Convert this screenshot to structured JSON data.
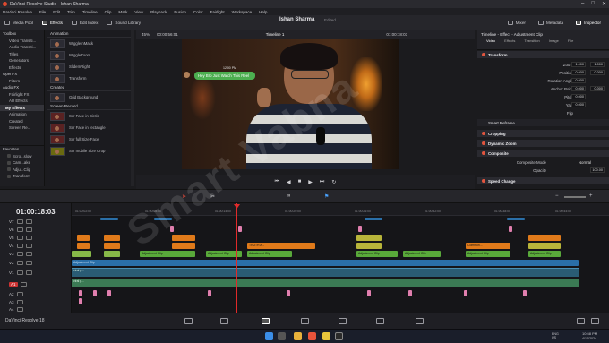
{
  "window": {
    "title": "DaVinci Resolve Studio - Ishan Sharma",
    "min": "–",
    "max": "□",
    "close": "✕"
  },
  "menu": [
    "DaVinci Resolve",
    "File",
    "Edit",
    "Trim",
    "Timeline",
    "Clip",
    "Mark",
    "View",
    "Playback",
    "Fusion",
    "Color",
    "Fairlight",
    "Workspace",
    "Help"
  ],
  "toolbar": {
    "media_pool": "Media Pool",
    "effects": "Effects",
    "edit_index": "Edit Index",
    "sound_library": "Sound Library",
    "project_name": "Ishan Sharma",
    "project_state": "Edited",
    "mixer": "Mixer",
    "metadata": "Metadata",
    "inspector": "Inspector"
  },
  "left_tree": {
    "items": [
      {
        "label": "Toolbox",
        "level": "head"
      },
      {
        "label": "Video Transiti...",
        "level": "sub"
      },
      {
        "label": "Audio Transiti...",
        "level": "sub"
      },
      {
        "label": "Titles",
        "level": "sub"
      },
      {
        "label": "Generators",
        "level": "sub"
      },
      {
        "label": "Effects",
        "level": "sub"
      },
      {
        "label": "OpenFX",
        "level": "head"
      },
      {
        "label": "Filters",
        "level": "sub"
      },
      {
        "label": "Audio FX",
        "level": "head"
      },
      {
        "label": "Fairlight FX",
        "level": "sub"
      },
      {
        "label": "AU Effects",
        "level": "sub"
      },
      {
        "label": "My Effects",
        "level": "selected"
      },
      {
        "label": "Animation",
        "level": "sub"
      },
      {
        "label": "Created",
        "level": "sub"
      },
      {
        "label": "Screen Re...",
        "level": "sub"
      }
    ],
    "favorites_title": "Favorites",
    "favorites": [
      "Scro...slow",
      "Cam...ake",
      "Adju...Clip",
      "Transform"
    ]
  },
  "fx_list": {
    "sections": [
      {
        "title": "Animation",
        "items": [
          {
            "label": "WiggleInMask",
            "thumb": "normal"
          },
          {
            "label": "WiggleZoom",
            "thumb": "normal"
          },
          {
            "label": "SlideInRight",
            "thumb": "normal"
          },
          {
            "label": "Transform",
            "thumb": "normal"
          }
        ]
      },
      {
        "title": "Created",
        "items": [
          {
            "label": "Grid Background",
            "thumb": "normal"
          }
        ]
      },
      {
        "title": "Screen Record",
        "items": [
          {
            "label": "Scr Face in Circle",
            "thumb": "red"
          },
          {
            "label": "Scr Face in rectangle",
            "thumb": "red"
          },
          {
            "label": "Scr full Size Face",
            "thumb": "red"
          },
          {
            "label": "Scr mobile Size Crop",
            "thumb": "yellow"
          }
        ]
      }
    ]
  },
  "viewer": {
    "zoom": "45%",
    "source_tc": "00:00:56:01",
    "timeline_name": "Timeline 1",
    "record_tc": "01:00:18:03",
    "chat_text": "Hey Bro Just Watch This Reel",
    "chat_time": "12:00 PM"
  },
  "watermark": "Smart Vabna",
  "inspector": {
    "header": "Timeline - Effect - Adjustment Clip",
    "tabs": [
      "Video",
      "Effects",
      "Transition",
      "Image",
      "File"
    ],
    "sections": {
      "transform": "Transform",
      "smart_reframe": "Smart Reframe",
      "cropping": "Cropping",
      "dynamic_zoom": "Dynamic Zoom",
      "composite": "Composite",
      "speed_change": "Speed Change"
    },
    "fields": [
      {
        "label": "Zoom",
        "x": "1.000",
        "y": "1.000"
      },
      {
        "label": "Position",
        "x": "0.000",
        "y": "0.000"
      },
      {
        "label": "Rotation Angle",
        "x": "0.000",
        "y": ""
      },
      {
        "label": "Anchor Point",
        "x": "0.000",
        "y": "0.000"
      },
      {
        "label": "Pitch",
        "x": "0.000",
        "y": ""
      },
      {
        "label": "Yaw",
        "x": "0.000",
        "y": ""
      },
      {
        "label": "Flip",
        "x": "",
        "y": ""
      }
    ],
    "composite_mode_label": "Composite Mode",
    "composite_mode_value": "Normal",
    "opacity_label": "Opacity",
    "opacity_value": "100.00"
  },
  "timeline": {
    "timecode": "01:00:18:03",
    "ruler": [
      "01:00:02:00",
      "01:00:08:00",
      "01:00:14:00",
      "01:00:20:00",
      "01:00:26:00",
      "01:00:32:00",
      "01:00:38:00",
      "01:00:44:00",
      "01:00:50:00"
    ],
    "tracks": [
      "V7",
      "V6",
      "V5",
      "V4",
      "V3",
      "V2",
      "V1",
      "A1",
      "A2",
      "A3",
      "A4"
    ],
    "adjustment_clip": "Adjustment Clip",
    "truth_label": "TRUTH A...",
    "common_label": "Common...",
    "audio_label": "viral g..."
  },
  "pages_bar": {
    "app_name": "DaVinci Resolve 18"
  },
  "taskbar": {
    "lang": "ENG US",
    "time": "10:58 PM",
    "date": "4/15/2024"
  },
  "colors": {
    "accent": "#e2553e",
    "playhead": "#e02a2a",
    "audio": "#3b7a54",
    "adjustment": "#2a6fa8"
  }
}
